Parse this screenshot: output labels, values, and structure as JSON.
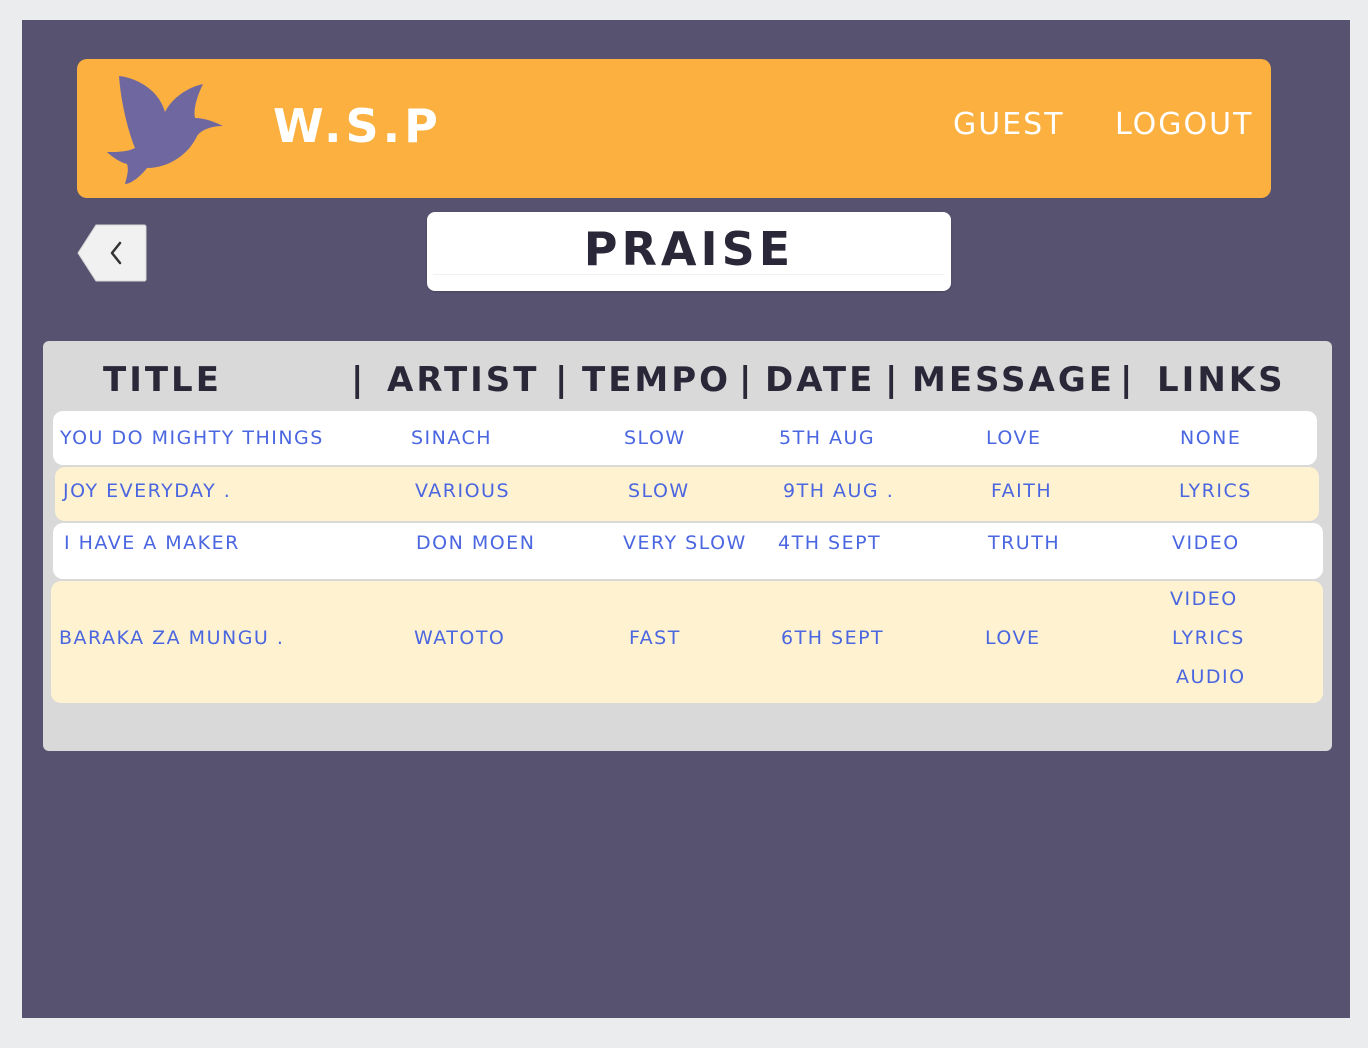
{
  "header": {
    "brand": "W.S.P",
    "nav": {
      "guest": "GUEST",
      "logout": "LOGOUT"
    },
    "logo_icon": "dove-icon"
  },
  "page": {
    "title": "PRAISE",
    "back_icon": "chevron-left-icon"
  },
  "table": {
    "columns": [
      "TITLE",
      "ARTIST",
      "TEMPO",
      "DATE",
      "MESSAGE",
      "LINKS"
    ],
    "separator": "|",
    "rows": [
      {
        "title": "YOU DO MIGHTY THINGS",
        "artist": "SINACH",
        "tempo": "SLOW",
        "date": "5TH AUG",
        "message": "LOVE",
        "links": [
          "NONE"
        ]
      },
      {
        "title": "JOY EVERYDAY .",
        "artist": "VARIOUS",
        "tempo": "SLOW",
        "date": "9TH AUG .",
        "message": "FAITH",
        "links": [
          "LYRICS"
        ]
      },
      {
        "title": "I HAVE A MAKER",
        "artist": "DON MOEN",
        "tempo": "VERY SLOW",
        "date": "4TH SEPT",
        "message": "TRUTH",
        "links": [
          "VIDEO"
        ]
      },
      {
        "title": "BARAKA ZA MUNGU .",
        "artist": "WATOTO",
        "tempo": "FAST",
        "date": "6TH SEPT",
        "message": "LOVE",
        "links": [
          "VIDEO",
          "LYRICS",
          "AUDIO"
        ]
      }
    ]
  },
  "colors": {
    "background": "#575270",
    "header": "#fbb040",
    "panel": "#d9d9d9",
    "row_alt": "#fff2d0",
    "link_text": "#4a66e0",
    "heading_text": "#2a2838",
    "logo": "#6f68a0"
  }
}
